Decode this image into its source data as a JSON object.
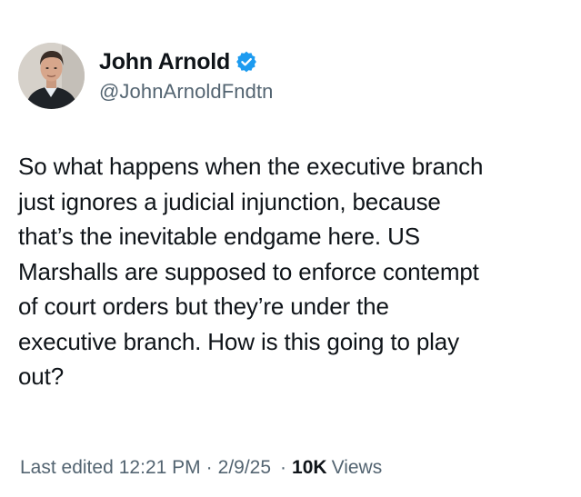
{
  "author": {
    "name": "John Arnold",
    "handle": "@JohnArnoldFndtn",
    "verified": true,
    "verified_color": "#1d9bf0"
  },
  "tweet": {
    "text": "So what happens when the executive branch\njust ignores a judicial injunction, because\nthat’s the inevitable endgame here. US\nMarshalls are supposed to enforce contempt\nof court orders but they’re under the\nexecutive branch. How is this going to play\nout?"
  },
  "meta": {
    "edited_label": "Last edited",
    "time": "12:21 PM",
    "separator": "·",
    "date": "2/9/25",
    "views_count": "10K",
    "views_label": "Views"
  },
  "colors": {
    "text": "#0f1419",
    "secondary": "#536471"
  }
}
